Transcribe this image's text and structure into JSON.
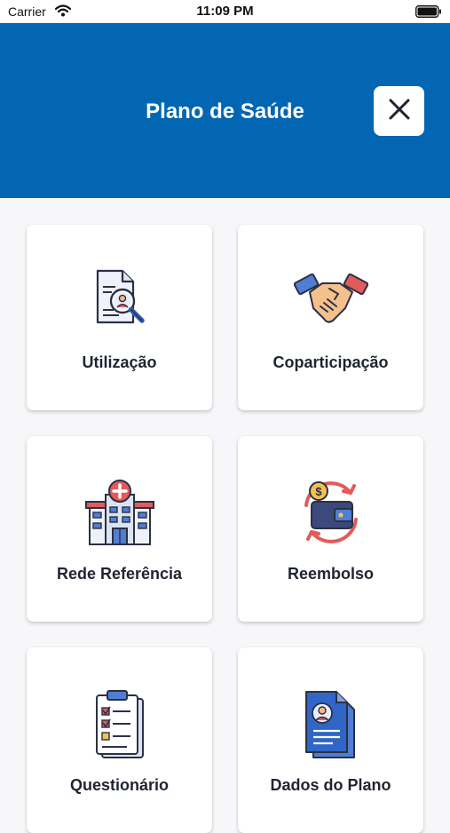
{
  "status_bar": {
    "carrier": "Carrier",
    "time": "11:09 PM"
  },
  "header": {
    "title": "Plano de Saúde",
    "close_icon": "close-icon"
  },
  "menu": [
    {
      "label": "Utilização",
      "icon": "document-search-icon"
    },
    {
      "label": "Coparticipação",
      "icon": "handshake-icon"
    },
    {
      "label": "Rede Referência",
      "icon": "hospital-icon"
    },
    {
      "label": "Reembolso",
      "icon": "wallet-refund-icon"
    },
    {
      "label": "Questionário",
      "icon": "clipboard-checklist-icon"
    },
    {
      "label": "Dados do Plano",
      "icon": "profile-document-icon"
    }
  ],
  "colors": {
    "header": "#0366b2",
    "background": "#f7f7f9",
    "card": "#ffffff"
  }
}
